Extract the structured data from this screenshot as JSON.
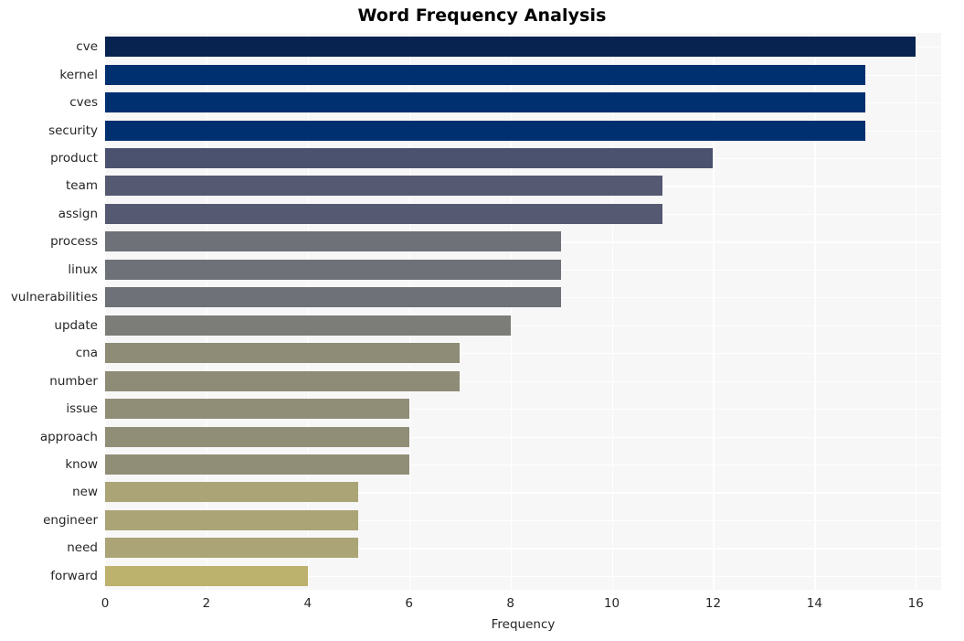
{
  "chart_data": {
    "type": "bar",
    "orientation": "horizontal",
    "title": "Word Frequency Analysis",
    "xlabel": "Frequency",
    "ylabel": "",
    "categories": [
      "cve",
      "kernel",
      "cves",
      "security",
      "product",
      "team",
      "assign",
      "process",
      "linux",
      "vulnerabilities",
      "update",
      "cna",
      "number",
      "issue",
      "approach",
      "know",
      "new",
      "engineer",
      "need",
      "forward"
    ],
    "values": [
      16,
      15,
      15,
      15,
      12,
      11,
      11,
      9,
      9,
      9,
      8,
      7,
      7,
      6,
      6,
      6,
      5,
      5,
      5,
      4
    ],
    "bar_colors": [
      "#082350",
      "#003070",
      "#003070",
      "#003070",
      "#4a5270",
      "#555a72",
      "#555a72",
      "#6e7177",
      "#6e7177",
      "#6e7177",
      "#7c7d79",
      "#8e8b77",
      "#8e8b77",
      "#918e78",
      "#918e78",
      "#918e78",
      "#aba477",
      "#aba477",
      "#aba477",
      "#bdb16e"
    ],
    "xlim": [
      0,
      16.5
    ],
    "xticks": [
      0,
      2,
      4,
      6,
      8,
      10,
      12,
      14,
      16
    ],
    "xtick_labels": [
      "0",
      "2",
      "4",
      "6",
      "8",
      "10",
      "12",
      "14",
      "16"
    ],
    "grid": true,
    "grid_color": "#ffffff",
    "plot_background": "#f7f7f7",
    "figure_background": "#ffffff",
    "legend": null
  }
}
